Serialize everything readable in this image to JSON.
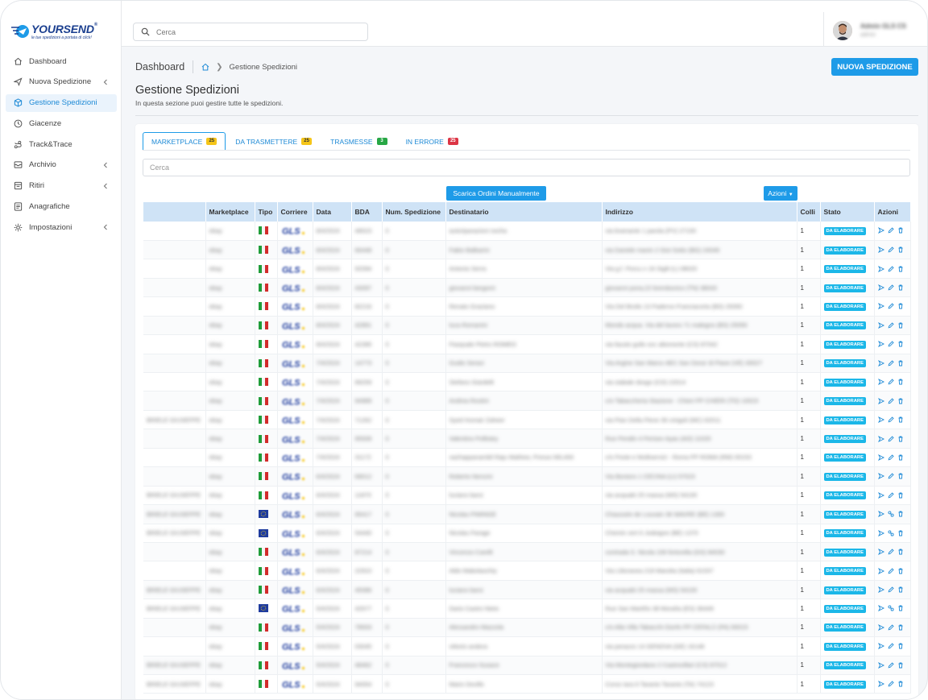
{
  "brand": {
    "name": "YOURSEND",
    "trademark": "®",
    "tagline": "le tue spedizioni a portata di click!"
  },
  "sidebar": {
    "items": [
      {
        "label": "Dashboard",
        "icon": "home-icon",
        "chevron": false,
        "active": false
      },
      {
        "label": "Nuova Spedizione",
        "icon": "send-icon",
        "chevron": true,
        "active": false
      },
      {
        "label": "Gestione Spedizioni",
        "icon": "box-icon",
        "chevron": false,
        "active": true
      },
      {
        "label": "Giacenze",
        "icon": "clock-icon",
        "chevron": false,
        "active": false
      },
      {
        "label": "Track&Trace",
        "icon": "route-icon",
        "chevron": false,
        "active": false
      },
      {
        "label": "Archivio",
        "icon": "archive-icon",
        "chevron": true,
        "active": false
      },
      {
        "label": "Ritiri",
        "icon": "pickup-icon",
        "chevron": true,
        "active": false
      },
      {
        "label": "Anagrafiche",
        "icon": "list-icon",
        "chevron": false,
        "active": false
      },
      {
        "label": "Impostazioni",
        "icon": "gear-icon",
        "chevron": true,
        "active": false
      }
    ]
  },
  "topbar": {
    "search_placeholder": "Cerca",
    "user_name": "Admin GLS CS",
    "user_role": "admin"
  },
  "breadcrumb": {
    "root": "Dashboard",
    "current": "Gestione Spedizioni"
  },
  "header": {
    "new_button": "NUOVA SPEDIZIONE",
    "title": "Gestione Spedizioni",
    "subtitle": "In questa sezione puoi gestire tutte le spedizioni."
  },
  "tabs": [
    {
      "label": "MARKETPLACE",
      "count": "25",
      "color": "#f5c518"
    },
    {
      "label": "DA TRASMETTERE",
      "count": "25",
      "color": "#f5c518"
    },
    {
      "label": "TRASMESSE",
      "count": "3",
      "color": "#27a745"
    },
    {
      "label": "IN ERRORE",
      "count": "25",
      "color": "#dc3545"
    }
  ],
  "table_search_placeholder": "Cerca",
  "buttons": {
    "scarica": "Scarica Ordini Manualmente",
    "azioni": "Azioni"
  },
  "table": {
    "columns": [
      "",
      "Marketplace",
      "Tipo",
      "Corriere",
      "Data",
      "BDA",
      "Num. Spedizione",
      "Destinatario",
      "Indirizzo",
      "Colli",
      "Stato",
      "Azioni"
    ],
    "rows": [
      {
        "sender": "",
        "market": "ebay",
        "flag": "it",
        "carrier": "GLS",
        "date": "8/4/2024",
        "bda": "48523",
        "num": "0",
        "dest": "autoriparazioni nezha",
        "addr": "via bramante 1 parola (PV) 27100",
        "colli": "1",
        "stato": "DA ELABORARE",
        "act": "edit"
      },
      {
        "sender": "",
        "market": "ebay",
        "flag": "it",
        "carrier": "GLS",
        "date": "8/4/2024",
        "bda": "66448",
        "num": "0",
        "dest": "Fabio Balbarini",
        "addr": "via Daniele manin 2 Gioi Sotto (BG) 24046",
        "colli": "1",
        "stato": "DA ELABORARE",
        "act": "edit"
      },
      {
        "sender": "",
        "market": "ebay",
        "flag": "it",
        "carrier": "GLS",
        "date": "8/4/2024",
        "bda": "92094",
        "num": "0",
        "dest": "Antonio Serra",
        "addr": "Via g.f. Porcu n 16 Sigili (L) 08020",
        "colli": "1",
        "stato": "DA ELABORARE",
        "act": "edit"
      },
      {
        "sender": "",
        "market": "ebay",
        "flag": "it",
        "carrier": "GLS",
        "date": "8/4/2024",
        "bda": "43097",
        "num": "0",
        "dest": "giovanni bergomi",
        "addr": "giovanni pona,22 brembonico (TN) 38043",
        "colli": "1",
        "stato": "DA ELABORARE",
        "act": "edit"
      },
      {
        "sender": "",
        "market": "ebay",
        "flag": "it",
        "carrier": "GLS",
        "date": "8/4/2024",
        "bda": "82216",
        "num": "0",
        "dest": "Renato Graziano",
        "addr": "Via Del Broilo 13 Paderno Franciacorta (BS) 25050",
        "colli": "1",
        "stato": "DA ELABORARE",
        "act": "edit"
      },
      {
        "sender": "",
        "market": "ebay",
        "flag": "it",
        "carrier": "GLS",
        "date": "8/4/2024",
        "bda": "42891",
        "num": "0",
        "dest": "luca Romanini",
        "addr": "Mondo acqua. Via del lavoro 71 malegno (BS) 25050",
        "colli": "1",
        "stato": "DA ELABORARE",
        "act": "edit"
      },
      {
        "sender": "",
        "market": "ebay",
        "flag": "it",
        "carrier": "GLS",
        "date": "8/4/2024",
        "bda": "42395",
        "num": "0",
        "dest": "Pasquale Pietro ROMEO",
        "addr": "via fausto gullo snc altomonte (CS) 87042",
        "colli": "1",
        "stato": "DA ELABORARE",
        "act": "edit"
      },
      {
        "sender": "",
        "market": "ebay",
        "flag": "it",
        "carrier": "GLS",
        "date": "7/4/2024",
        "bda": "14773",
        "num": "0",
        "dest": "Guido Seraci",
        "addr": "Via Argine San Marco 48/1 San Dona' di Piave (VE) 30027",
        "colli": "1",
        "stato": "DA ELABORARE",
        "act": "edit"
      },
      {
        "sender": "",
        "market": "ebay",
        "flag": "it",
        "carrier": "GLS",
        "date": "7/4/2024",
        "bda": "89259",
        "num": "0",
        "dest": "Stefano Giardelli",
        "addr": "via stabale dosgo (CO) 22014",
        "colli": "1",
        "stato": "DA ELABORARE",
        "act": "edit"
      },
      {
        "sender": "",
        "market": "ebay",
        "flag": "it",
        "carrier": "GLS",
        "date": "7/4/2024",
        "bda": "94989",
        "num": "0",
        "dest": "Andrea Rostini",
        "addr": "c/o Tabaccheria Stazione - Chieri PP CHIERI (TO) 10023",
        "colli": "1",
        "stato": "DA ELABORARE",
        "act": "edit"
      },
      {
        "sender": "BRIELE GIUSEPPE",
        "market": "ebay",
        "flag": "it",
        "carrier": "GLS",
        "date": "7/4/2024",
        "bda": "71262",
        "num": "0",
        "dest": "Syed Humair Zaheer",
        "addr": "via Pian Della Pieve 36 cinigoli (MC) 62011",
        "colli": "1",
        "stato": "DA ELABORARE",
        "act": "edit"
      },
      {
        "sender": "",
        "market": "ebay",
        "flag": "it",
        "carrier": "GLS",
        "date": "7/4/2024",
        "bda": "95939",
        "num": "0",
        "dest": "Valentino Pollistey",
        "addr": "Rue Pendin 4 Perisev Ayas (AO) 11020",
        "colli": "1",
        "stato": "DA ELABORARE",
        "act": "edit"
      },
      {
        "sender": "",
        "market": "ebay",
        "flag": "it",
        "carrier": "GLS",
        "date": "7/4/2024",
        "bda": "31172",
        "num": "0",
        "dest": "vazhappanambil Raju Mathew, Presso MILANI",
        "addr": "c/o Poste e Multiservizi - Roma PP ROMA (RM) 00153",
        "colli": "1",
        "stato": "DA ELABORARE",
        "act": "edit"
      },
      {
        "sender": "",
        "market": "ebay",
        "flag": "it",
        "carrier": "GLS",
        "date": "6/4/2024",
        "bda": "69012",
        "num": "0",
        "dest": "Roberto Nencini",
        "addr": "Via Bonioro 1 CECINA (LI) 57023",
        "colli": "1",
        "stato": "DA ELABORARE",
        "act": "edit"
      },
      {
        "sender": "BRIELE GIUSEPPE",
        "market": "ebay",
        "flag": "it",
        "carrier": "GLS",
        "date": "6/4/2024",
        "bda": "11870",
        "num": "0",
        "dest": "luciano barsi",
        "addr": "via acquabi 25 massa (MS) 54100",
        "colli": "1",
        "stato": "DA ELABORARE",
        "act": "edit"
      },
      {
        "sender": "BRIELE GIUSEPPE",
        "market": "ebay",
        "flag": "eu",
        "carrier": "GLS",
        "date": "6/4/2024",
        "bda": "95417",
        "num": "0",
        "dest": "Nicolas PIMINGE",
        "addr": "Chaussée de Louvain 36 WAVRE (BE) 1300",
        "colli": "1",
        "stato": "DA ELABORARE",
        "act": "link"
      },
      {
        "sender": "BRIELE GIUSEPPE",
        "market": "ebay",
        "flag": "eu",
        "carrier": "GLS",
        "date": "6/4/2024",
        "bda": "54440",
        "num": "0",
        "dest": "Nicolas Parage",
        "addr": "Chemin vert 6 Jodoigne (BE) 1370",
        "colli": "1",
        "stato": "DA ELABORARE",
        "act": "link"
      },
      {
        "sender": "",
        "market": "ebay",
        "flag": "it",
        "carrier": "GLS",
        "date": "6/4/2024",
        "bda": "87214",
        "num": "0",
        "dest": "Vincenzo Carelli",
        "addr": "contrada S. Nicola 106 fortorella (GS) 84030",
        "colli": "1",
        "stato": "DA ELABORARE",
        "act": "edit"
      },
      {
        "sender": "",
        "market": "ebay",
        "flag": "it",
        "carrier": "GLS",
        "date": "6/4/2024",
        "bda": "22910",
        "num": "0",
        "dest": "Aldo Mabolaochiy",
        "addr": "Via Littoranea 218 Marotta (Italia) 61037",
        "colli": "1",
        "stato": "DA ELABORARE",
        "act": "edit"
      },
      {
        "sender": "BRIELE GIUSEPPE",
        "market": "ebay",
        "flag": "it",
        "carrier": "GLS",
        "date": "6/4/2024",
        "bda": "45086",
        "num": "0",
        "dest": "luciano barsi",
        "addr": "via acquabi 25 massa (MS) 54100",
        "colli": "1",
        "stato": "DA ELABORARE",
        "act": "edit"
      },
      {
        "sender": "BRIELE GIUSEPPE",
        "market": "ebay",
        "flag": "eu",
        "carrier": "GLS",
        "date": "5/4/2024",
        "bda": "42677",
        "num": "0",
        "dest": "Dario Castro Nieto",
        "addr": "Rue San Martiño 38 Morañа (ES) 36449",
        "colli": "1",
        "stato": "DA ELABORARE",
        "act": "link"
      },
      {
        "sender": "",
        "market": "ebay",
        "flag": "it",
        "carrier": "GLS",
        "date": "5/4/2024",
        "bda": "78933",
        "num": "0",
        "dest": "Alessandro Mazzola",
        "addr": "c/o Alla Villa Tabacchi Giorfo PP CEFALÙ (PA) 90015",
        "colli": "1",
        "stato": "DA ELABORARE",
        "act": "edit"
      },
      {
        "sender": "",
        "market": "ebay",
        "flag": "it",
        "carrier": "GLS",
        "date": "5/4/2024",
        "bda": "03045",
        "num": "0",
        "dest": "vittorio andora",
        "addr": "via perazzo 14 GENOVA (GE) 16148",
        "colli": "1",
        "stato": "DA ELABORARE",
        "act": "edit"
      },
      {
        "sender": "BRIELE GIUSEPPE",
        "market": "ebay",
        "flag": "it",
        "carrier": "GLS",
        "date": "5/4/2024",
        "bda": "48462",
        "num": "0",
        "dest": "Francesco Susace",
        "addr": "Via Montegiordano 2 Castrovillari (CS) 87012",
        "colli": "1",
        "stato": "DA ELABORARE",
        "act": "edit"
      },
      {
        "sender": "BRIELE GIUSEPPE",
        "market": "ebay",
        "flag": "it",
        "carrier": "GLS",
        "date": "5/4/2024",
        "bda": "94054",
        "num": "0",
        "dest": "Mario Devillo",
        "addr": "Corso Iara 6 Taranto Taranto (TA) 74123",
        "colli": "1",
        "stato": "DA ELABORARE",
        "act": "edit"
      }
    ]
  },
  "colors": {
    "accent": "#1e9be8",
    "header_bg": "#cfe3f6",
    "stato_bg": "#1bb7e8",
    "brand": "#1b3f8f"
  }
}
